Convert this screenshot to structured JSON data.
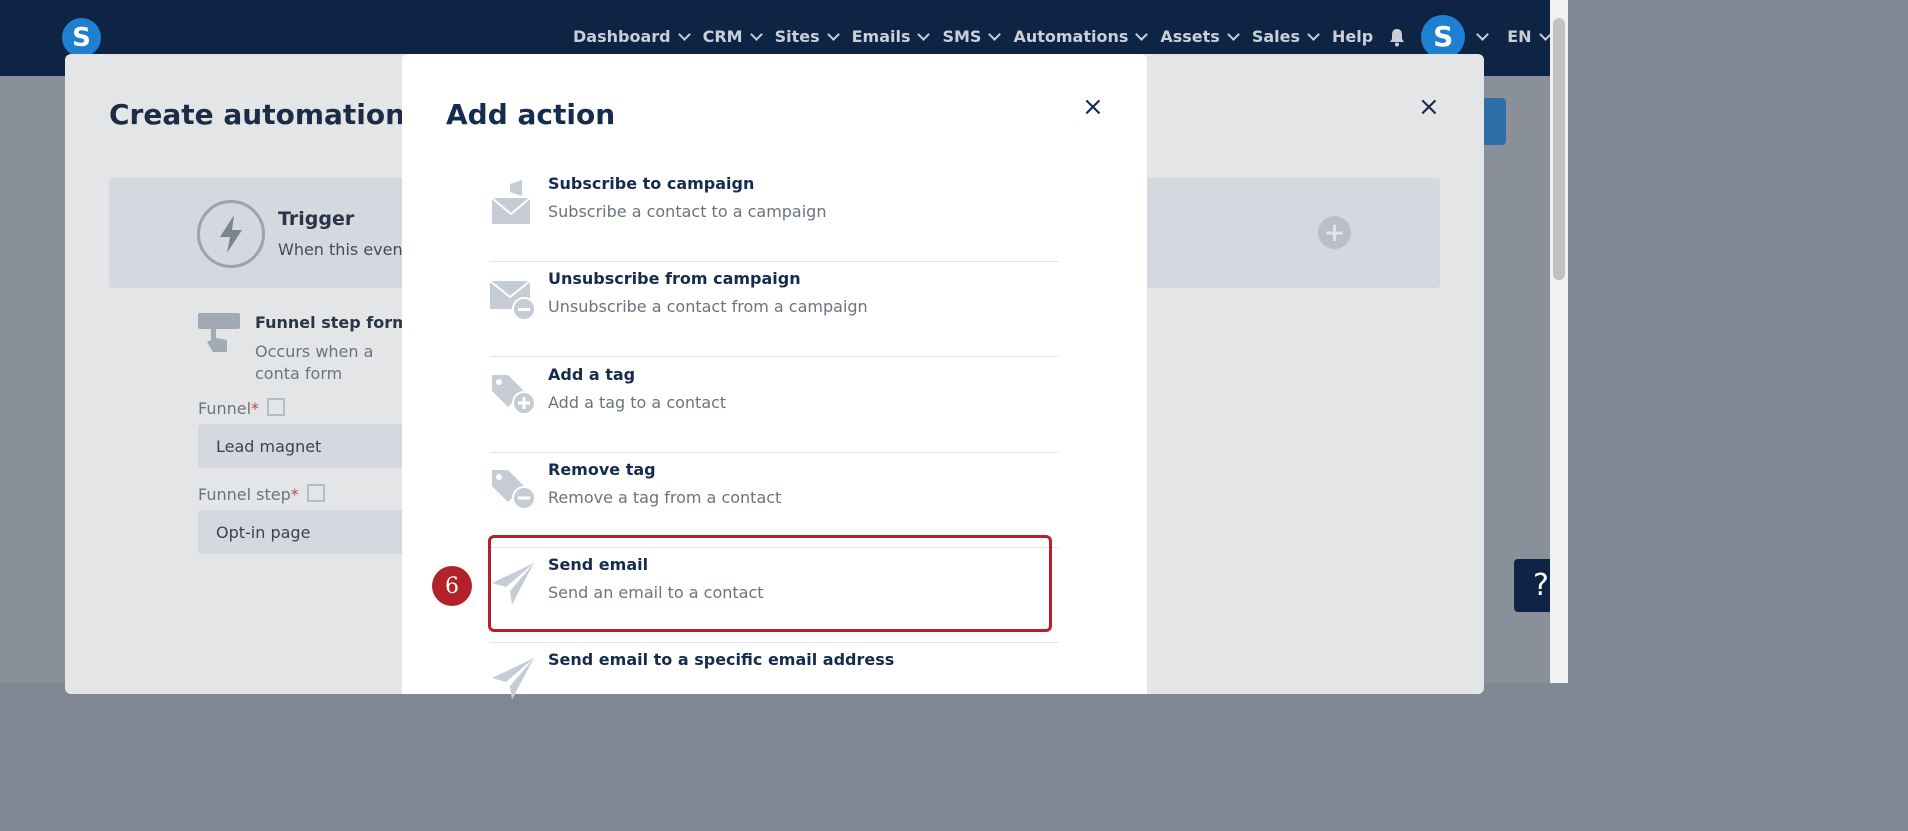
{
  "nav": {
    "items": [
      "Dashboard",
      "CRM",
      "Sites",
      "Emails",
      "SMS",
      "Automations",
      "Assets",
      "Sales"
    ],
    "help": "Help",
    "language": "EN",
    "logo_letter": "S",
    "avatar_letter": "S"
  },
  "outer": {
    "title": "Create automation rule",
    "close": "×",
    "trigger_title": "Trigger",
    "trigger_sub": "When this event h",
    "funnel_title": "Funnel step form su",
    "funnel_desc": "Occurs when a conta form",
    "funnel_label": "Funnel",
    "funnel_value": "Lead magnet",
    "funnel_step_label": "Funnel step",
    "funnel_step_value": "Opt-in page",
    "required": "*"
  },
  "modal": {
    "title": "Add action",
    "close": "×",
    "actions": [
      {
        "name": "Subscribe to campaign",
        "desc": "Subscribe a contact to a campaign",
        "icon": "megaphone-envelope-icon"
      },
      {
        "name": "Unsubscribe from campaign",
        "desc": "Unsubscribe a contact from a campaign",
        "icon": "envelope-minus-icon"
      },
      {
        "name": "Add a tag",
        "desc": "Add a tag to a contact",
        "icon": "tag-plus-icon"
      },
      {
        "name": "Remove tag",
        "desc": "Remove a tag from a contact",
        "icon": "tag-minus-icon"
      },
      {
        "name": "Send email",
        "desc": "Send an email to a contact",
        "icon": "paper-plane-icon"
      },
      {
        "name": "Send email to a specific email address",
        "desc": "",
        "icon": "paper-plane-icon"
      }
    ]
  },
  "annotation": {
    "step": "6"
  },
  "help_button": "?"
}
